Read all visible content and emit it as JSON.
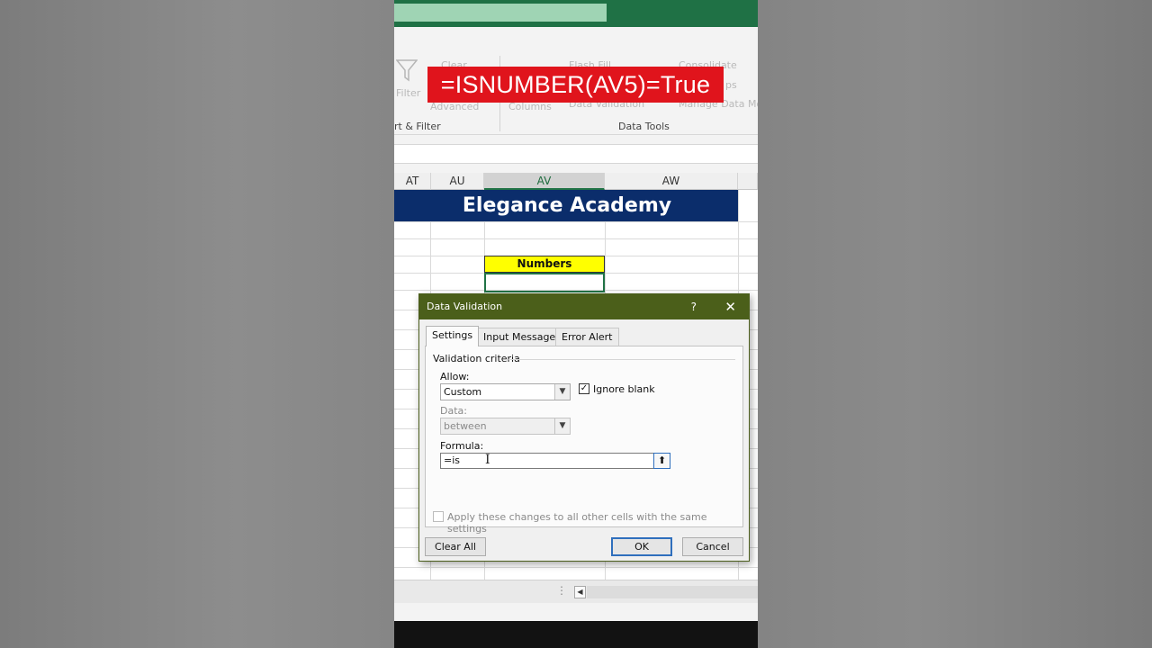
{
  "overlay_caption": "=ISNUMBER(AV5)=True",
  "ribbon": {
    "filter": "Filter",
    "clear": "Clear",
    "advanced": "Advanced",
    "columns": "Columns",
    "flash_fill": "Flash Fill",
    "data_validation": "Data Validation",
    "consolidate": "Consolidate",
    "relationships": "ps",
    "manage_data_model": "Manage Data Mo",
    "group_sort_filter": "rt & Filter",
    "group_data_tools": "Data Tools"
  },
  "sheet": {
    "columns": [
      "AT",
      "AU",
      "AV",
      "AW"
    ],
    "banner": "Elegance Academy",
    "header_cell": "Numbers"
  },
  "dialog": {
    "title": "Data Validation",
    "help": "?",
    "close": "✕",
    "tabs": [
      "Settings",
      "Input Message",
      "Error Alert"
    ],
    "section": "Validation criteria",
    "allow_label": "Allow:",
    "allow_value": "Custom",
    "ignore_blank": "Ignore blank",
    "ignore_blank_checked": true,
    "data_label": "Data:",
    "data_value": "between",
    "formula_label": "Formula:",
    "formula_value": "=is",
    "apply_all": "Apply these changes to all other cells with the same settings",
    "buttons": {
      "clear_all": "Clear All",
      "ok": "OK",
      "cancel": "Cancel"
    }
  },
  "colors": {
    "title_bar": "#1f7145",
    "dialog_title": "#4b5f1a",
    "banner": "#0b2d6b",
    "caption_bg": "#e0141c",
    "header_fill": "#ffff00"
  }
}
